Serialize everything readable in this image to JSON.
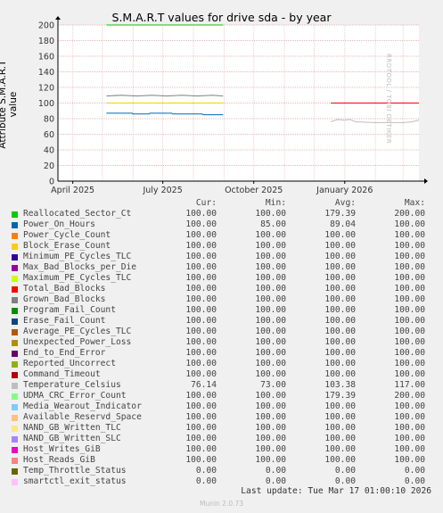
{
  "colors": {
    "background": "#f0f0f0",
    "plot_bg": "#ffffff",
    "grid": "#e6b8b8",
    "axis": "#000000"
  },
  "chart_data": {
    "type": "line",
    "title": "S.M.A.R.T values for drive sda - by year",
    "ylabel": "Attribute S.M.A.R.T value",
    "side_note": "RRDTOOL / TOBI OETIKER",
    "ylim": [
      0,
      200
    ],
    "yticks": [
      0,
      20,
      40,
      60,
      80,
      100,
      120,
      140,
      160,
      180,
      200
    ],
    "x_range": [
      "2025-03-17",
      "2026-03-17"
    ],
    "xtick_labels": [
      {
        "date": "2025-04-01",
        "label": "April 2025"
      },
      {
        "date": "2025-07-01",
        "label": "July 2025"
      },
      {
        "date": "2025-10-01",
        "label": "October 2025"
      },
      {
        "date": "2026-01-01",
        "label": "January 2026"
      }
    ],
    "grid": true,
    "legend_position": "bottom",
    "column_headers": [
      "Cur:",
      "Min:",
      "Avg:",
      "Max:"
    ],
    "series": [
      {
        "name": "Reallocated_Sector_Ct",
        "color": "#00cc00",
        "cur": "100.00",
        "min": "100.00",
        "avg": "179.39",
        "max": "200.00",
        "points": [
          [
            "2025-05-05",
            200
          ],
          [
            "2025-08-31",
            200
          ]
        ]
      },
      {
        "name": "Power_On_Hours",
        "color": "#0066b3",
        "cur": "100.00",
        "min": "85.00",
        "avg": "89.04",
        "max": "100.00",
        "points": [
          [
            "2025-05-05",
            87
          ],
          [
            "2025-05-31",
            87
          ],
          [
            "2025-06-01",
            86
          ],
          [
            "2025-06-17",
            86
          ],
          [
            "2025-06-18",
            87
          ],
          [
            "2025-07-10",
            87
          ],
          [
            "2025-07-11",
            86
          ],
          [
            "2025-08-10",
            86
          ],
          [
            "2025-08-11",
            85
          ],
          [
            "2025-08-31",
            85
          ]
        ]
      },
      {
        "name": "Power_Cycle_Count",
        "color": "#ff8000",
        "cur": "100.00",
        "min": "100.00",
        "avg": "100.00",
        "max": "100.00",
        "points": [
          [
            "2025-05-05",
            100
          ],
          [
            "2025-08-31",
            100
          ]
        ]
      },
      {
        "name": "Block_Erase_Count",
        "color": "#ffcc00",
        "cur": "100.00",
        "min": "100.00",
        "avg": "100.00",
        "max": "100.00",
        "points": [
          [
            "2025-05-05",
            100
          ],
          [
            "2025-08-31",
            100
          ]
        ]
      },
      {
        "name": "Minimum_PE_Cycles_TLC",
        "color": "#330099",
        "cur": "100.00",
        "min": "100.00",
        "avg": "100.00",
        "max": "100.00",
        "points": []
      },
      {
        "name": "Max_Bad_Blocks_per_Die",
        "color": "#990099",
        "cur": "100.00",
        "min": "100.00",
        "avg": "100.00",
        "max": "100.00",
        "points": []
      },
      {
        "name": "Maximum_PE_Cycles_TLC",
        "color": "#ccff00",
        "cur": "100.00",
        "min": "100.00",
        "avg": "100.00",
        "max": "100.00",
        "points": []
      },
      {
        "name": "Total_Bad_Blocks",
        "color": "#ff0000",
        "cur": "100.00",
        "min": "100.00",
        "avg": "100.00",
        "max": "100.00",
        "points": [
          [
            "2025-12-18",
            100
          ],
          [
            "2026-01-31",
            100
          ],
          [
            "2026-03-02",
            100
          ],
          [
            "2026-03-17",
            100
          ]
        ]
      },
      {
        "name": "Grown_Bad_Blocks",
        "color": "#808080",
        "cur": "100.00",
        "min": "100.00",
        "avg": "100.00",
        "max": "100.00",
        "points": [
          [
            "2025-05-05",
            109
          ],
          [
            "2025-05-20",
            110
          ],
          [
            "2025-06-05",
            109
          ],
          [
            "2025-06-20",
            110
          ],
          [
            "2025-07-05",
            109
          ],
          [
            "2025-07-20",
            110
          ],
          [
            "2025-08-05",
            109
          ],
          [
            "2025-08-20",
            110
          ],
          [
            "2025-08-31",
            109
          ]
        ]
      },
      {
        "name": "Program_Fail_Count",
        "color": "#008f00",
        "cur": "100.00",
        "min": "100.00",
        "avg": "100.00",
        "max": "100.00",
        "points": []
      },
      {
        "name": "Erase_Fail_Count",
        "color": "#00487d",
        "cur": "100.00",
        "min": "100.00",
        "avg": "100.00",
        "max": "100.00",
        "points": []
      },
      {
        "name": "Average_PE_Cycles_TLC",
        "color": "#b35a00",
        "cur": "100.00",
        "min": "100.00",
        "avg": "100.00",
        "max": "100.00",
        "points": []
      },
      {
        "name": "Unexpected_Power_Loss",
        "color": "#b38f00",
        "cur": "100.00",
        "min": "100.00",
        "avg": "100.00",
        "max": "100.00",
        "points": []
      },
      {
        "name": "End_to_End_Error",
        "color": "#6b006b",
        "cur": "100.00",
        "min": "100.00",
        "avg": "100.00",
        "max": "100.00",
        "points": []
      },
      {
        "name": "Reported_Uncorrect",
        "color": "#8fb300",
        "cur": "100.00",
        "min": "100.00",
        "avg": "100.00",
        "max": "100.00",
        "points": []
      },
      {
        "name": "Command_Timeout",
        "color": "#b30000",
        "cur": "100.00",
        "min": "100.00",
        "avg": "100.00",
        "max": "100.00",
        "points": []
      },
      {
        "name": "Temperature_Celsius",
        "color": "#bebebe",
        "cur": "76.14",
        "min": "73.00",
        "avg": "103.38",
        "max": "117.00",
        "points": [
          [
            "2025-12-18",
            76
          ],
          [
            "2025-12-25",
            79
          ],
          [
            "2025-12-31",
            78
          ],
          [
            "2026-01-06",
            79
          ],
          [
            "2026-01-12",
            76
          ],
          [
            "2026-01-31",
            75
          ],
          [
            "2026-03-02",
            75
          ],
          [
            "2026-03-10",
            76
          ],
          [
            "2026-03-17",
            78
          ]
        ]
      },
      {
        "name": "UDMA_CRC_Error_Count",
        "color": "#80ff80",
        "cur": "100.00",
        "min": "100.00",
        "avg": "179.39",
        "max": "200.00",
        "points": []
      },
      {
        "name": "Media_Wearout_Indicator",
        "color": "#80c9ff",
        "cur": "100.00",
        "min": "100.00",
        "avg": "100.00",
        "max": "100.00",
        "points": []
      },
      {
        "name": "Available_Reservd_Space",
        "color": "#ffc080",
        "cur": "100.00",
        "min": "100.00",
        "avg": "100.00",
        "max": "100.00",
        "points": []
      },
      {
        "name": "NAND_GB_Written_TLC",
        "color": "#ffe680",
        "cur": "100.00",
        "min": "100.00",
        "avg": "100.00",
        "max": "100.00",
        "points": []
      },
      {
        "name": "NAND_GB_Written_SLC",
        "color": "#aa80ff",
        "cur": "100.00",
        "min": "100.00",
        "avg": "100.00",
        "max": "100.00",
        "points": []
      },
      {
        "name": "Host_Writes_GiB",
        "color": "#ee00cc",
        "cur": "100.00",
        "min": "100.00",
        "avg": "100.00",
        "max": "100.00",
        "points": []
      },
      {
        "name": "Host_Reads_GiB",
        "color": "#ff8080",
        "cur": "100.00",
        "min": "100.00",
        "avg": "100.00",
        "max": "100.00",
        "points": []
      },
      {
        "name": "Temp_Throttle_Status",
        "color": "#666600",
        "cur": "0.00",
        "min": "0.00",
        "avg": "0.00",
        "max": "0.00",
        "points": [
          [
            "2025-03-17",
            0
          ],
          [
            "2026-03-17",
            0
          ]
        ]
      },
      {
        "name": "smartctl_exit_status",
        "color": "#ffbfff",
        "cur": "0.00",
        "min": "0.00",
        "avg": "0.00",
        "max": "0.00",
        "points": [
          [
            "2025-03-17",
            0
          ],
          [
            "2026-03-17",
            0
          ]
        ]
      }
    ]
  },
  "last_update": "Last update: Tue Mar 17 01:00:10 2026",
  "footer": "Munin 2.0.73"
}
